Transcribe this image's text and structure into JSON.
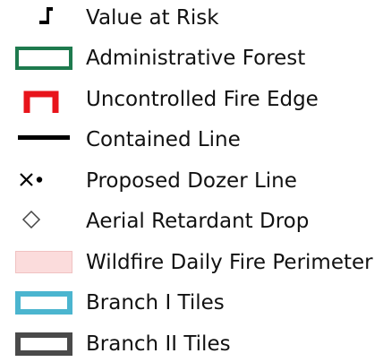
{
  "legend": {
    "items": [
      {
        "label": "Value at Risk",
        "icon": "value-at-risk-flag-icon"
      },
      {
        "label": "Administrative Forest",
        "icon": "administrative-forest-outline-icon",
        "color": "#1e7a4e"
      },
      {
        "label": "Uncontrolled Fire Edge",
        "icon": "uncontrolled-fire-edge-icon",
        "color": "#e8141b"
      },
      {
        "label": "Contained Line",
        "icon": "contained-line-icon",
        "color": "#000000"
      },
      {
        "label": "Proposed Dozer Line",
        "icon": "proposed-dozer-line-icon",
        "color": "#000000"
      },
      {
        "label": "Aerial Retardant Drop",
        "icon": "aerial-retardant-drop-diamond-icon",
        "color": "#444444"
      },
      {
        "label": "Wildfire Daily Fire Perimeter",
        "icon": "wildfire-perimeter-fill-icon",
        "color": "#fbdcdc"
      },
      {
        "label": "Branch I Tiles",
        "icon": "branch-i-tiles-outline-icon",
        "color": "#4bb5cf"
      },
      {
        "label": "Branch II Tiles",
        "icon": "branch-ii-tiles-outline-icon",
        "color": "#4a4a4a"
      }
    ]
  }
}
